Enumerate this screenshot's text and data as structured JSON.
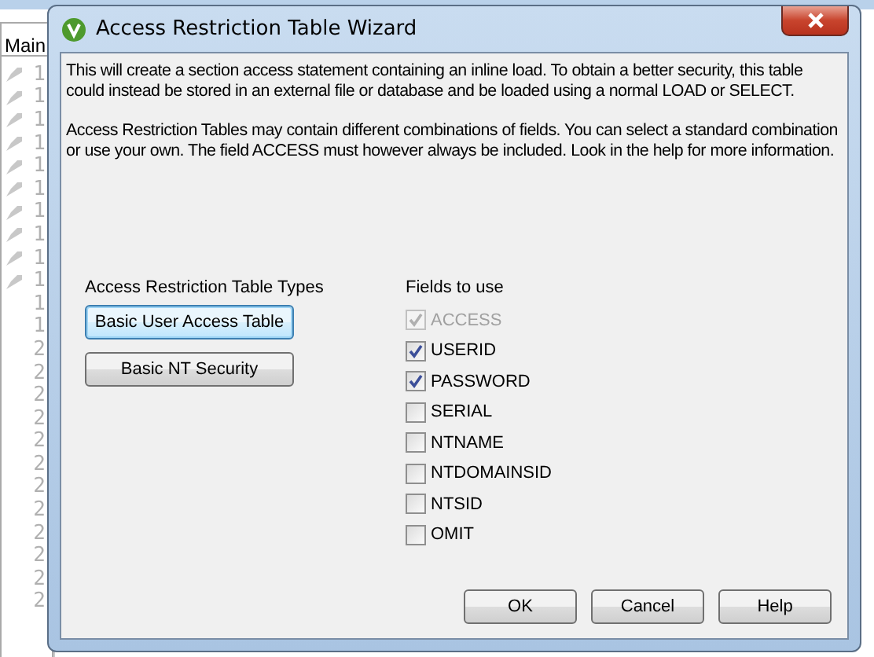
{
  "editor": {
    "tab": "Main",
    "lines": [
      {
        "number": "1",
        "marker": true
      },
      {
        "number": "1",
        "marker": true
      },
      {
        "number": "1",
        "marker": true
      },
      {
        "number": "1",
        "marker": true
      },
      {
        "number": "1",
        "marker": true
      },
      {
        "number": "1",
        "marker": true
      },
      {
        "number": "1",
        "marker": true
      },
      {
        "number": "1",
        "marker": true
      },
      {
        "number": "1",
        "marker": true
      },
      {
        "number": "1",
        "marker": true
      },
      {
        "number": "1",
        "marker": false
      },
      {
        "number": "1",
        "marker": false
      },
      {
        "number": "2",
        "marker": false
      },
      {
        "number": "2",
        "marker": false
      },
      {
        "number": "2",
        "marker": false
      },
      {
        "number": "2",
        "marker": false
      },
      {
        "number": "2",
        "marker": false
      },
      {
        "number": "2",
        "marker": false
      },
      {
        "number": "2",
        "marker": false
      },
      {
        "number": "2",
        "marker": false
      },
      {
        "number": "2",
        "marker": false
      },
      {
        "number": "2",
        "marker": false
      },
      {
        "number": "2",
        "marker": false
      },
      {
        "number": "2",
        "marker": false
      }
    ]
  },
  "dialog": {
    "title": "Access Restriction Table Wizard",
    "paragraphs": [
      "This will create a section access statement containing an inline load. To obtain a better security, this table could instead be stored in an external file or database and be loaded using a normal LOAD or SELECT.",
      "Access Restriction Tables may contain different combinations of fields. You can select a standard combination or use your own. The field ACCESS must however always be included. Look in the help for more information."
    ],
    "types_label": "Access Restriction Table Types",
    "type_buttons": [
      {
        "label": "Basic User Access Table",
        "focused": true
      },
      {
        "label": "Basic NT Security",
        "focused": false
      }
    ],
    "fields_label": "Fields to use",
    "fields": [
      {
        "label": "ACCESS",
        "checked": true,
        "disabled": true
      },
      {
        "label": "USERID",
        "checked": true,
        "disabled": false
      },
      {
        "label": "PASSWORD",
        "checked": true,
        "disabled": false
      },
      {
        "label": "SERIAL",
        "checked": false,
        "disabled": false
      },
      {
        "label": "NTNAME",
        "checked": false,
        "disabled": false
      },
      {
        "label": "NTDOMAINSID",
        "checked": false,
        "disabled": false
      },
      {
        "label": "NTSID",
        "checked": false,
        "disabled": false
      },
      {
        "label": "OMIT",
        "checked": false,
        "disabled": false
      }
    ],
    "buttons": [
      "OK",
      "Cancel",
      "Help"
    ]
  }
}
